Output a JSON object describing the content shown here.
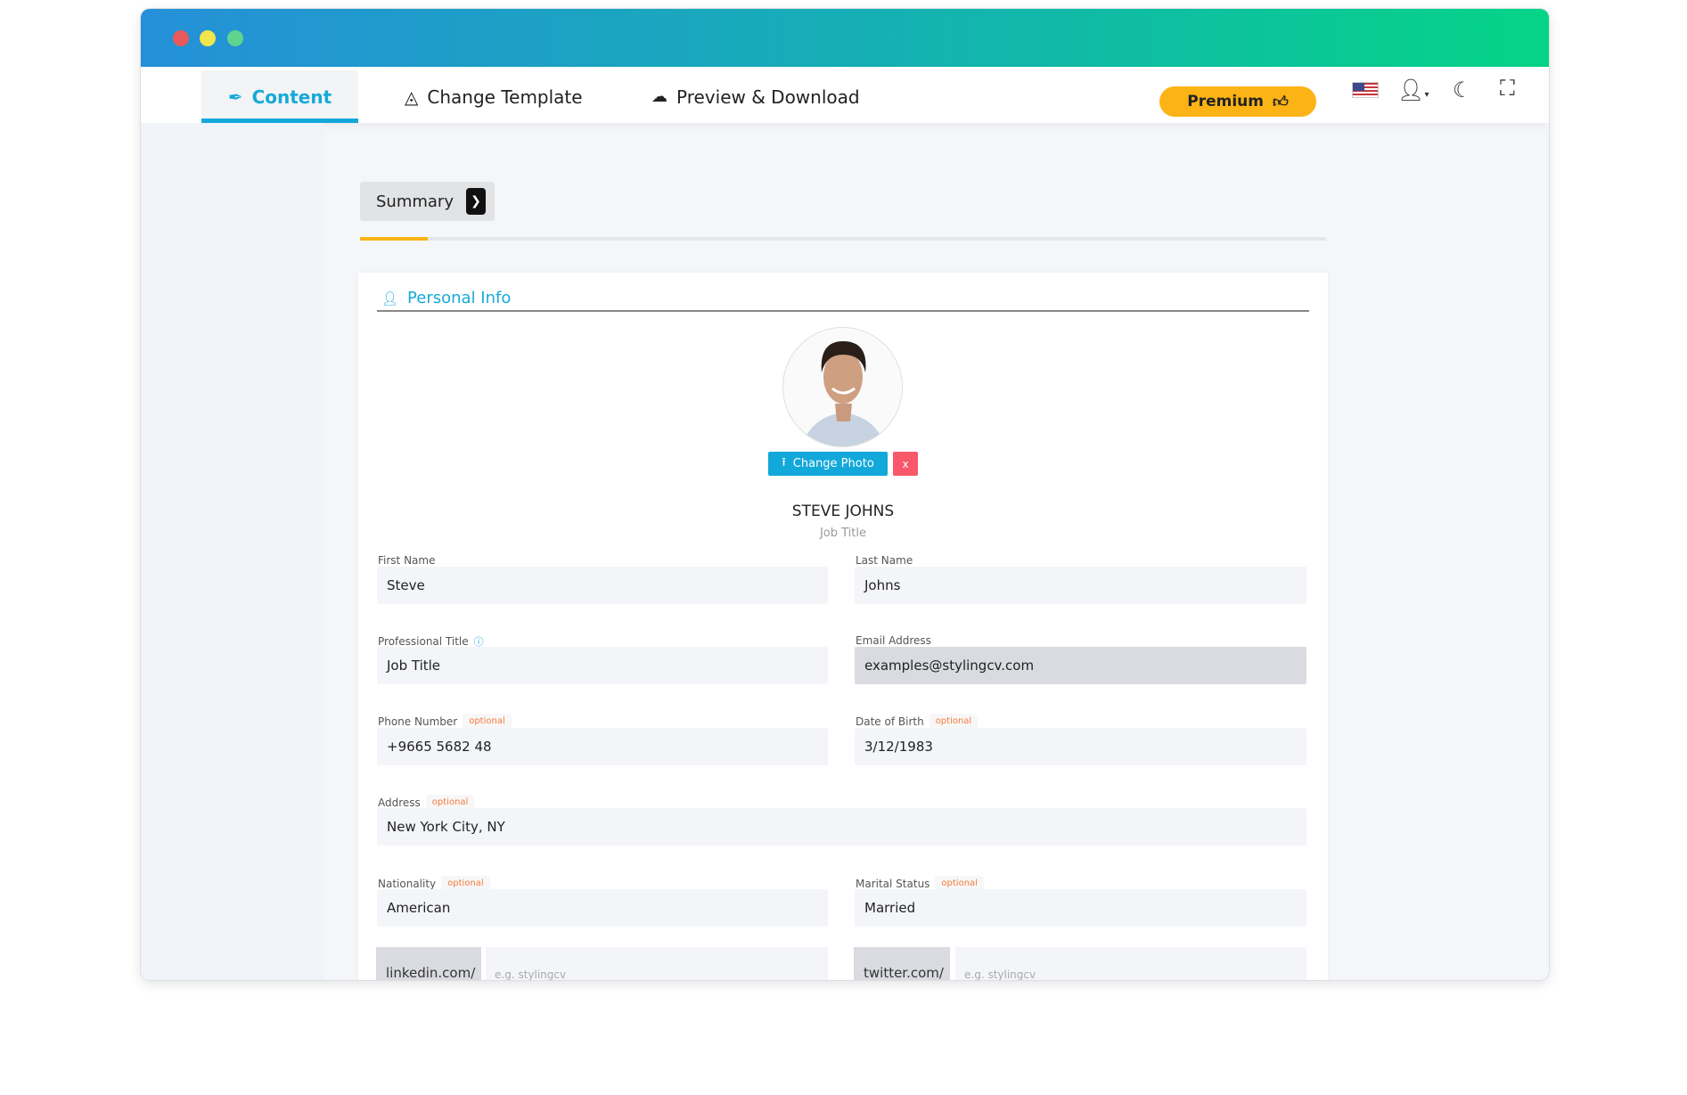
{
  "window": {
    "controls": [
      "close",
      "minimize",
      "maximize"
    ],
    "colors": {
      "close": "#e85a5a",
      "minimize": "#f0e64a",
      "maximize": "#5fd48e"
    }
  },
  "nav": {
    "tabs": [
      {
        "label": "Content",
        "icon": "feather-icon",
        "active": true
      },
      {
        "label": "Change Template",
        "icon": "template-icon",
        "active": false
      },
      {
        "label": "Preview & Download",
        "icon": "cloud-download-icon",
        "active": false
      }
    ],
    "premium_label": "Premium",
    "accent": "#13a8da",
    "premium_color": "#fcb315"
  },
  "section": {
    "summary_label": "Summary",
    "progress_percent": 7
  },
  "personal_info": {
    "title": "Personal Info",
    "change_photo_label": "Change Photo",
    "remove_photo_label": "x",
    "full_name": "STEVE JOHNS",
    "job_title": "Job Title",
    "optional_label": "optional",
    "fields": {
      "first_name": {
        "label": "First Name",
        "value": "Steve"
      },
      "last_name": {
        "label": "Last Name",
        "value": "Johns"
      },
      "professional_title": {
        "label": "Professional Title",
        "value": "Job Title"
      },
      "email": {
        "label": "Email Address",
        "value": "examples@stylingcv.com"
      },
      "phone": {
        "label": "Phone Number",
        "value": "+9665 5682 48"
      },
      "dob": {
        "label": "Date of Birth",
        "value": "3/12/1983"
      },
      "address": {
        "label": "Address",
        "value": "New York City, NY"
      },
      "nationality": {
        "label": "Nationality",
        "value": "American"
      },
      "marital": {
        "label": "Marital Status",
        "value": "Married"
      },
      "linkedin": {
        "prefix": "linkedin.com/",
        "placeholder": "e.g. stylingcv"
      },
      "twitter": {
        "prefix": "twitter.com/",
        "placeholder": "e.g. stylingcv"
      }
    }
  }
}
